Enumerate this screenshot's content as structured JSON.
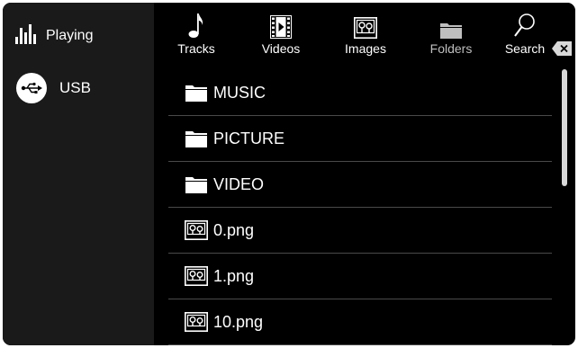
{
  "sidebar": {
    "now_playing": {
      "label": "Playing",
      "icon": "equalizer-bars-icon"
    },
    "sources": [
      {
        "label": "USB",
        "icon": "usb-icon"
      }
    ]
  },
  "tabs": [
    {
      "label": "Tracks",
      "icon": "music-note-icon",
      "active": false
    },
    {
      "label": "Videos",
      "icon": "film-icon",
      "active": false
    },
    {
      "label": "Images",
      "icon": "image-icon",
      "active": false
    },
    {
      "label": "Folders",
      "icon": "folder-icon",
      "active": true
    },
    {
      "label": "Search",
      "icon": "search-icon",
      "active": false
    }
  ],
  "backspace_icon": "backspace-icon",
  "list": {
    "items": [
      {
        "type": "folder",
        "label": "MUSIC"
      },
      {
        "type": "folder",
        "label": "PICTURE"
      },
      {
        "type": "folder",
        "label": "VIDEO"
      },
      {
        "type": "image",
        "label": "0.png"
      },
      {
        "type": "image",
        "label": "1.png"
      },
      {
        "type": "image",
        "label": "10.png"
      }
    ]
  },
  "colors": {
    "background": "#000000",
    "sidebar": "#1a1a1a",
    "text": "#ffffff",
    "active_tab_text": "#bfbfbf",
    "divider": "#4a4a4a"
  }
}
